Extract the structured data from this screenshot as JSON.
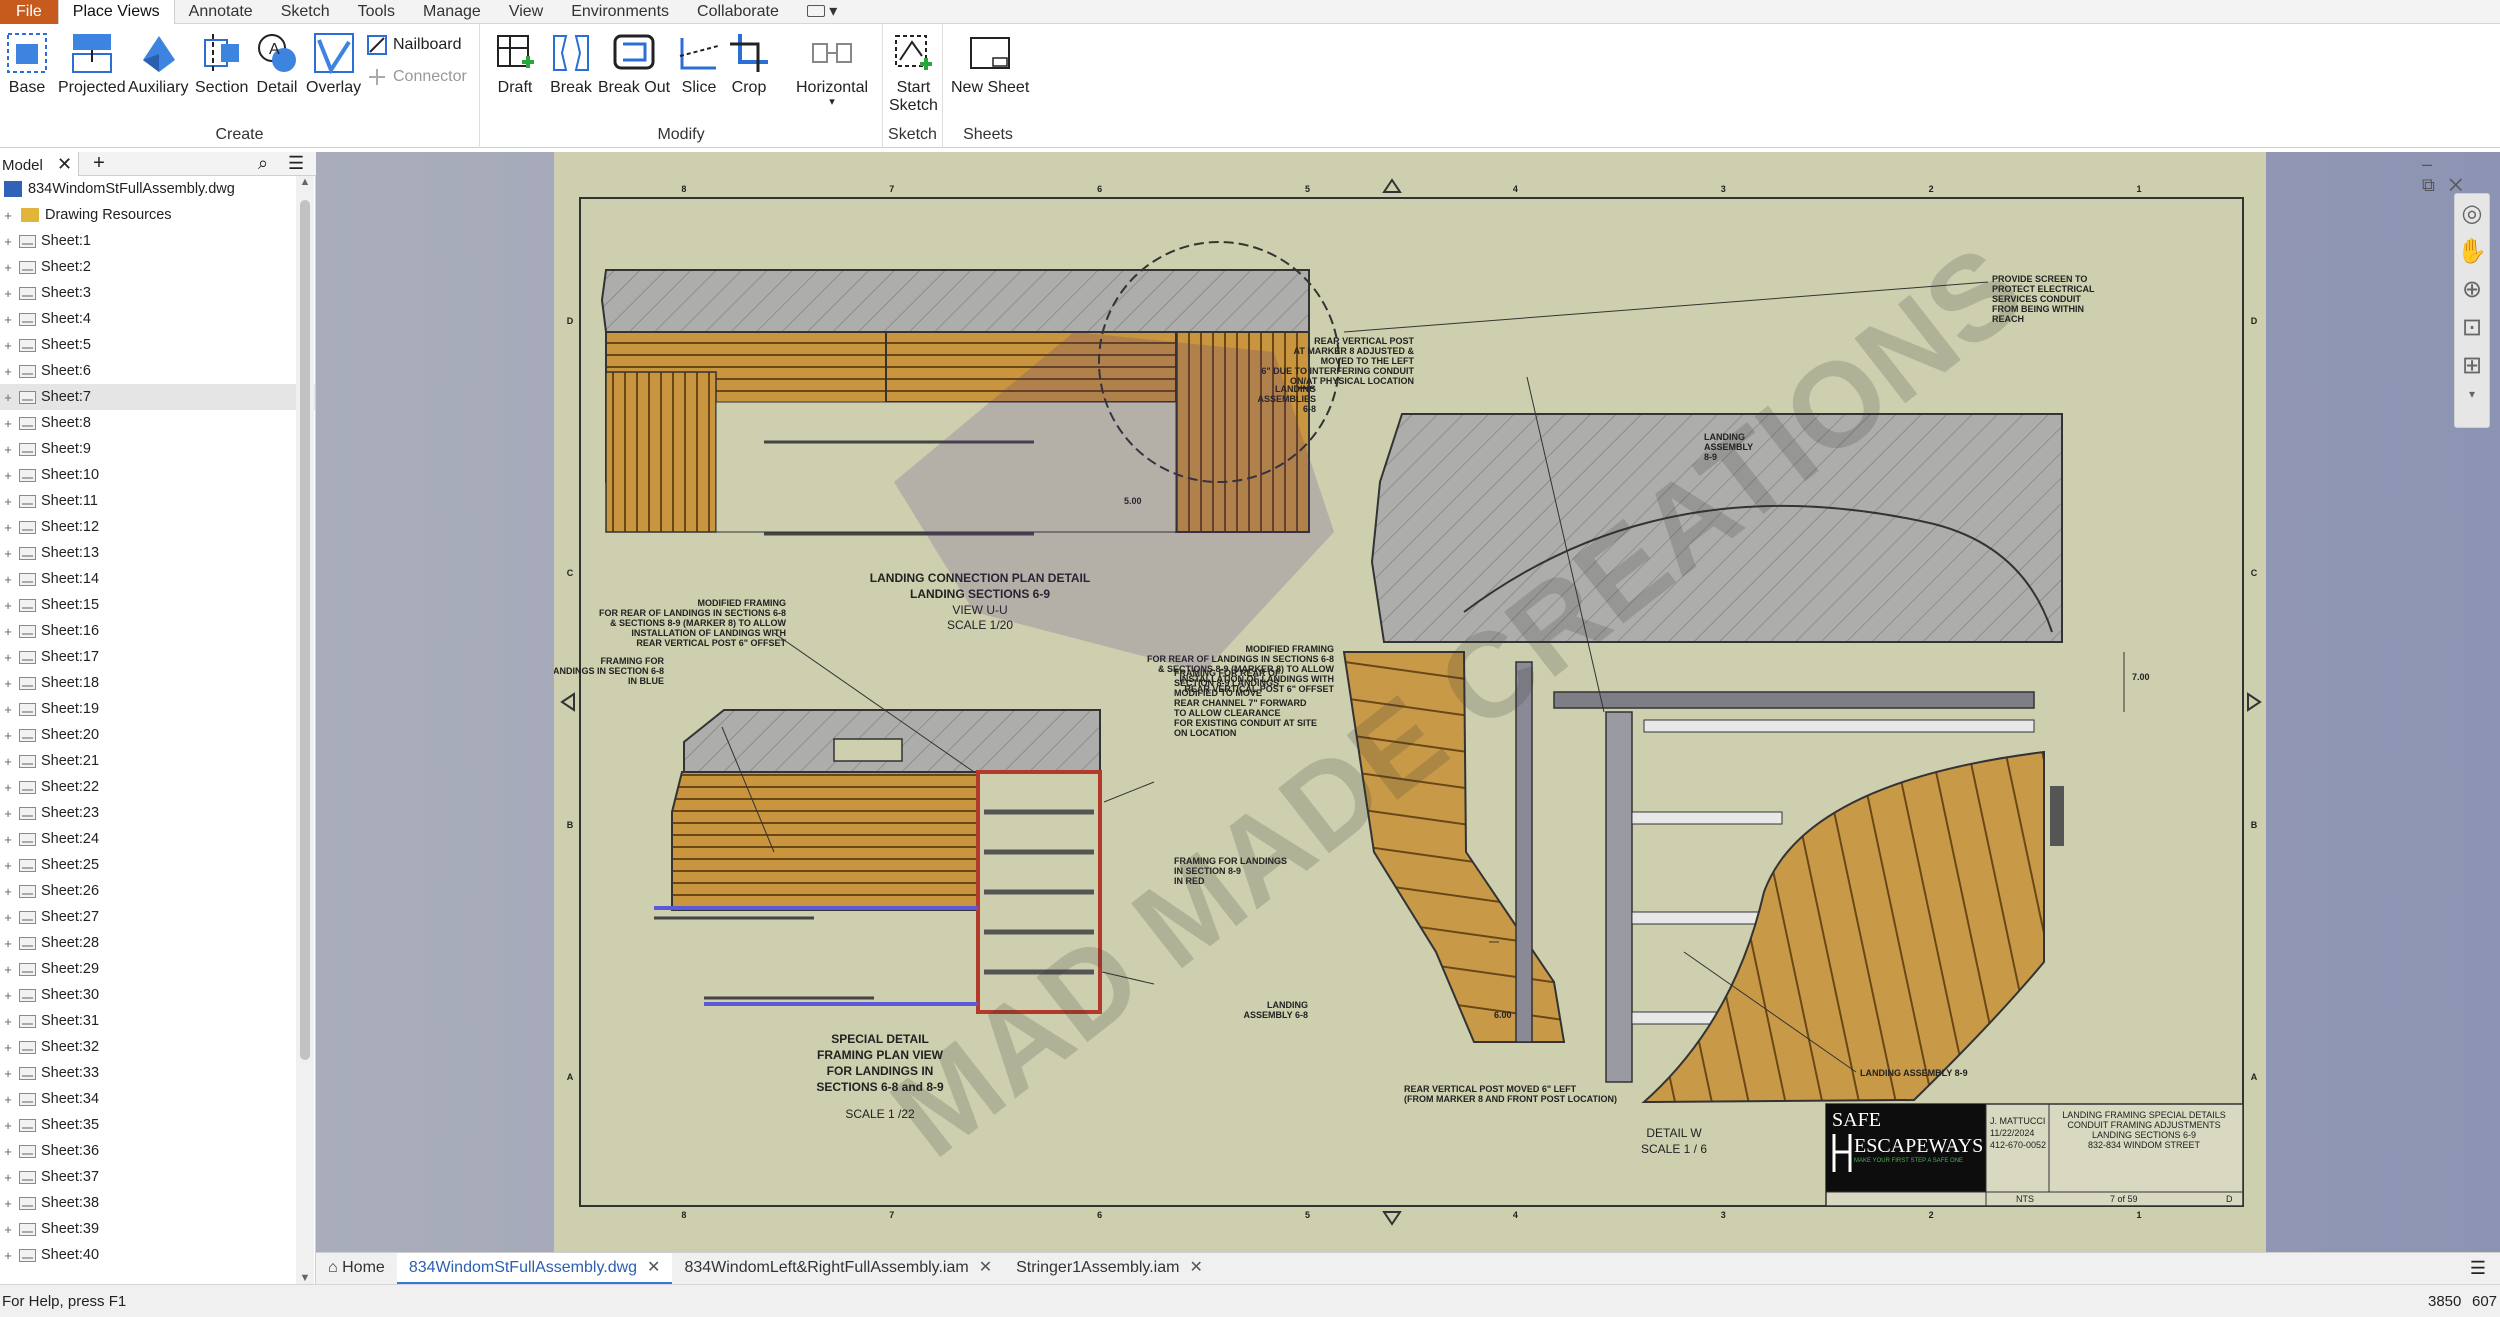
{
  "menu": {
    "tabs": [
      "File",
      "Place Views",
      "Annotate",
      "Sketch",
      "Tools",
      "Manage",
      "View",
      "Environments",
      "Collaborate"
    ],
    "active_tab": "Place Views"
  },
  "ribbon": {
    "create": {
      "label": "Create",
      "buttons": [
        "Base",
        "Projected",
        "Auxiliary",
        "Section",
        "Detail",
        "Overlay"
      ],
      "small": [
        "Nailboard",
        "Connector"
      ]
    },
    "modify": {
      "label": "Modify",
      "buttons": [
        "Draft",
        "Break",
        "Break Out",
        "Slice",
        "Crop",
        "Horizontal"
      ]
    },
    "sketch": {
      "label": "Sketch",
      "button_line1": "Start",
      "button_line2": "Sketch"
    },
    "sheets": {
      "label": "Sheets",
      "button": "New Sheet"
    }
  },
  "browser": {
    "tab_label": "Model",
    "file": "834WindomStFullAssembly.dwg",
    "resources": "Drawing Resources",
    "selected": "Sheet:7",
    "sheets": [
      "Sheet:1",
      "Sheet:2",
      "Sheet:3",
      "Sheet:4",
      "Sheet:5",
      "Sheet:6",
      "Sheet:7",
      "Sheet:8",
      "Sheet:9",
      "Sheet:10",
      "Sheet:11",
      "Sheet:12",
      "Sheet:13",
      "Sheet:14",
      "Sheet:15",
      "Sheet:16",
      "Sheet:17",
      "Sheet:18",
      "Sheet:19",
      "Sheet:20",
      "Sheet:21",
      "Sheet:22",
      "Sheet:23",
      "Sheet:24",
      "Sheet:25",
      "Sheet:26",
      "Sheet:27",
      "Sheet:28",
      "Sheet:29",
      "Sheet:30",
      "Sheet:31",
      "Sheet:32",
      "Sheet:33",
      "Sheet:34",
      "Sheet:35",
      "Sheet:36",
      "Sheet:37",
      "Sheet:38",
      "Sheet:39",
      "Sheet:40"
    ]
  },
  "drawing": {
    "view1": {
      "title": "LANDING CONNECTION PLAN DETAIL",
      "subtitle": "LANDING SECTIONS 6-9",
      "view": "VIEW U-U",
      "scale": "SCALE 1/20"
    },
    "view2": {
      "line1": "SPECIAL DETAIL",
      "line2": "FRAMING PLAN VIEW",
      "line3": "FOR LANDINGS IN",
      "line4": "SECTIONS 6-8 and 8-9",
      "scale": "SCALE 1 /22"
    },
    "view3": {
      "title": "DETAIL  W",
      "scale": "SCALE 1 / 6"
    },
    "notes": {
      "provide_screen": [
        "PROVIDE SCREEN TO",
        "PROTECT ELECTRICAL",
        "SERVICES CONDUIT",
        "FROM BEING WITHIN",
        "REACH"
      ],
      "rear_post": [
        "REAR VERTICAL POST",
        "AT MARKER 8 ADJUSTED &",
        "MOVED TO THE LEFT",
        "6\" DUE TO INTERFERING CONDUIT",
        "ON/AT PHYSICAL LOCATION"
      ],
      "mod_framing_1": [
        "MODIFIED FRAMING",
        "FOR REAR OF LANDINGS IN SECTIONS 6-8",
        "& SECTIONS 8-9 (MARKER 8) TO ALLOW",
        "INSTALLATION OF LANDINGS WITH",
        "REAR VERTICAL POST 6\" OFFSET"
      ],
      "framing_blue": [
        "FRAMING FOR",
        "LANDINGS IN SECTION 6-8",
        "IN BLUE"
      ],
      "framing_rear": [
        "FRAMING FOR REAR OF",
        "SECTION 8-9 LANDINGS",
        "MODIFIED TO MOVE",
        "REAR CHANNEL 7\" FORWARD",
        "TO ALLOW CLEARANCE",
        "FOR EXISTING CONDUIT AT SITE",
        "ON LOCATION"
      ],
      "framing_red": [
        "FRAMING FOR LANDINGS",
        "IN SECTION 8-9",
        "IN RED"
      ],
      "landing_assemblies": [
        "LANDING",
        "ASSEMBLIES",
        "6-8"
      ],
      "landing_assembly_89": [
        "LANDING",
        "ASSEMBLY",
        "8-9"
      ],
      "landing_assembly_68": [
        "LANDING",
        "ASSEMBLY 6-8"
      ],
      "rear_post_moved": [
        "REAR VERTICAL POST MOVED 6\" LEFT",
        "(FROM MARKER 8 AND FRONT POST LOCATION)"
      ],
      "landing_assembly_89b": "LANDING ASSEMBLY 8-9",
      "dim_700": "7.00",
      "dim_600": "6.00",
      "dim_500": "5.00"
    },
    "title_block": {
      "logo_line1": "SAFE",
      "logo_line2": "ESCAPEWAYS",
      "tagline": "MAKE YOUR FIRST STEP A SAFE ONE",
      "drawn_by": "J. MATTUCCI",
      "date": "11/22/2024",
      "phone": "412-670-0052",
      "title": [
        "LANDING FRAMING SPECIAL DETAILS",
        "CONDUIT FRAMING ADJUSTMENTS",
        "LANDING SECTIONS 6-9",
        "832-834 WINDOM STREET"
      ],
      "scale": "NTS",
      "sheet": "7 of 59",
      "size": "D"
    },
    "watermark": "MAD MADE CREATIONS",
    "border_cols": [
      "8",
      "7",
      "6",
      "5",
      "4",
      "3",
      "2",
      "1"
    ],
    "border_rows": [
      "D",
      "C",
      "B",
      "A"
    ]
  },
  "doc_tabs": {
    "home": "Home",
    "tabs": [
      "834WindomStFullAssembly.dwg",
      "834WindomLeft&RightFullAssembly.iam",
      "Stringer1Assembly.iam"
    ],
    "active": "834WindomStFullAssembly.dwg"
  },
  "status": {
    "help": "For Help, press F1",
    "n1": "3850",
    "n2": "607"
  }
}
